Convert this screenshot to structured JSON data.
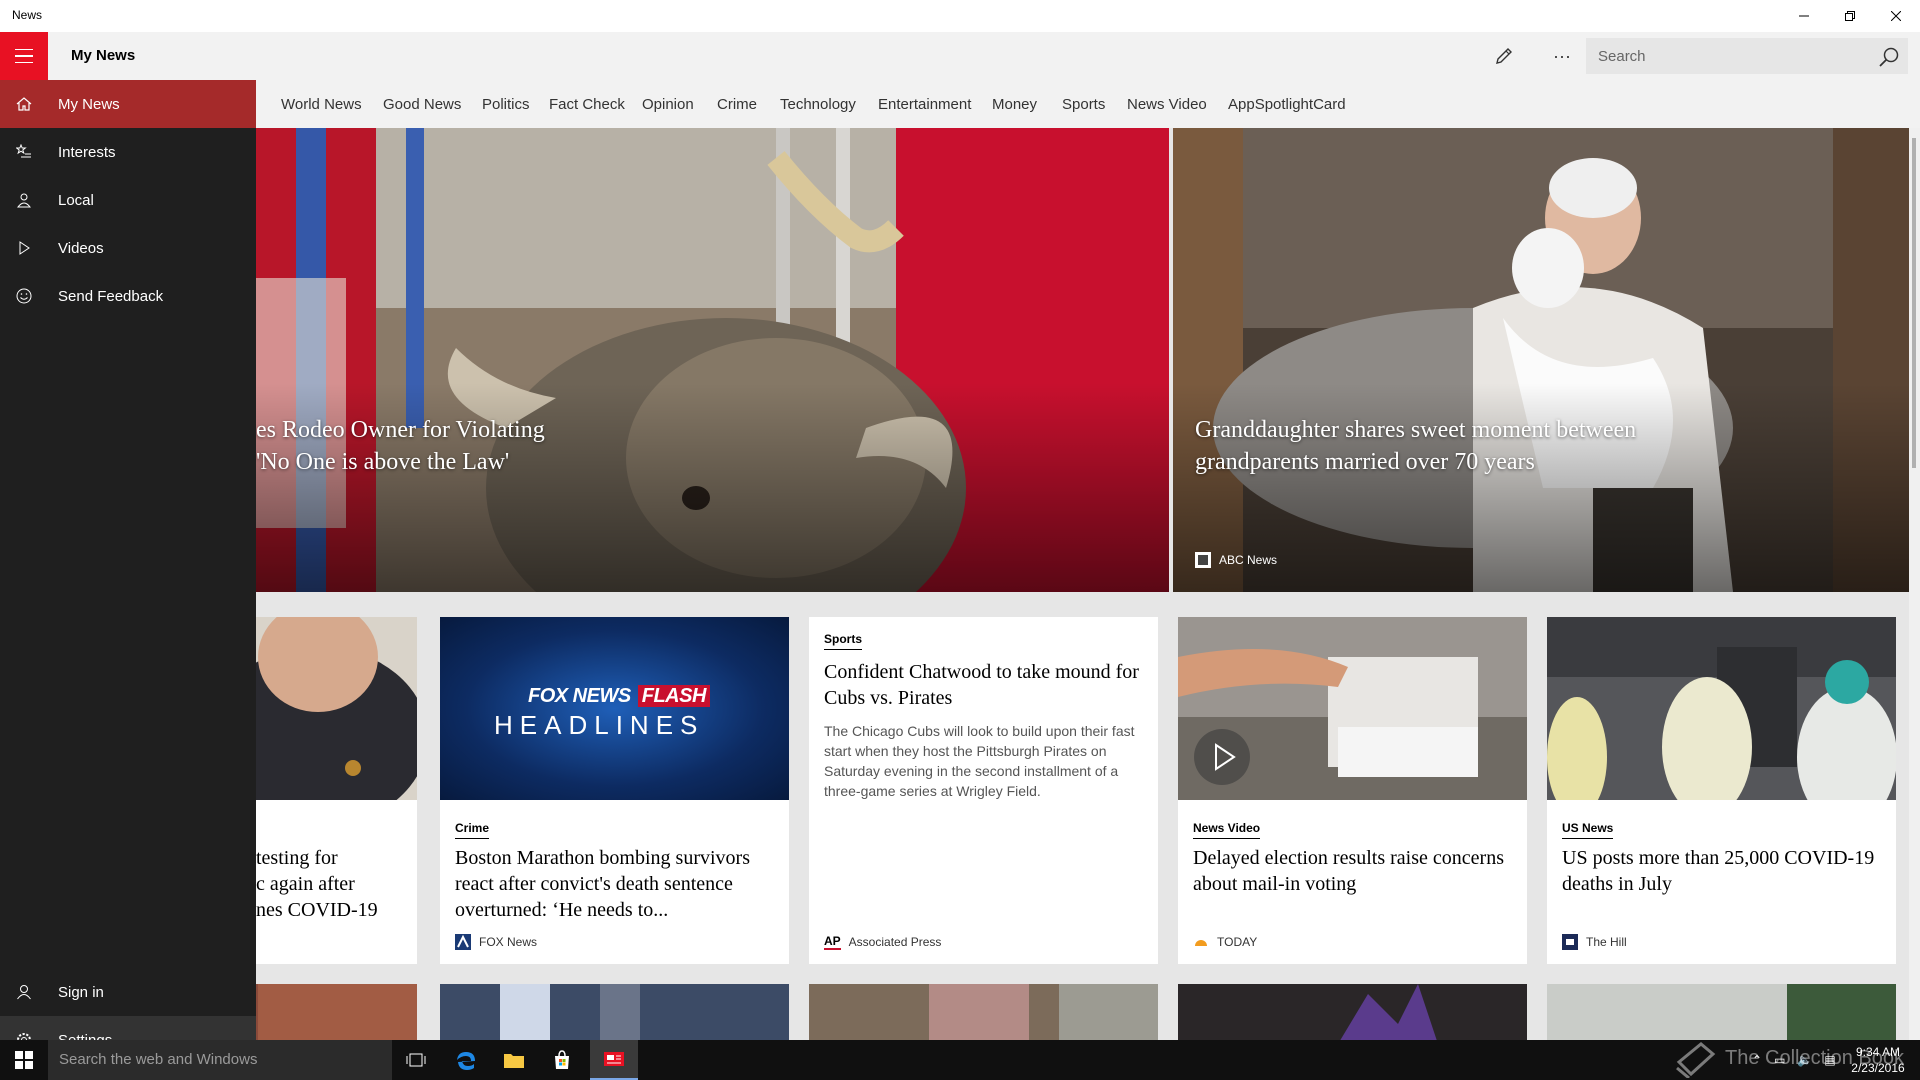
{
  "window": {
    "title": "News",
    "minimize": "–",
    "restore": "❐",
    "close": "✕"
  },
  "header": {
    "title": "My News",
    "search_placeholder": "Search",
    "more_label": "···"
  },
  "tabs": [
    "World News",
    "Good News",
    "Politics",
    "Fact Check",
    "Opinion",
    "Crime",
    "Technology",
    "Entertainment",
    "Money",
    "Sports",
    "News Video",
    "AppSpotlightCard"
  ],
  "pane": {
    "items": [
      {
        "label": "My News",
        "icon": "home-icon"
      },
      {
        "label": "Interests",
        "icon": "star-list-icon"
      },
      {
        "label": "Local",
        "icon": "person-pin-icon"
      },
      {
        "label": "Videos",
        "icon": "play-icon"
      },
      {
        "label": "Send Feedback",
        "icon": "smiley-icon"
      }
    ],
    "bottom": [
      {
        "label": "Sign in",
        "icon": "person-icon"
      },
      {
        "label": "Settings",
        "icon": "gear-icon"
      }
    ]
  },
  "hero": [
    {
      "headline_line1": "es Rodeo Owner for Violating",
      "headline_line2": "'No One is above the Law'"
    },
    {
      "headline_line1": "Granddaughter shares sweet moment between",
      "headline_line2": "grandparents married over 70 years",
      "source": "ABC News"
    }
  ],
  "cards": [
    {
      "category": "",
      "title_lines": [
        "testing for",
        "c again after",
        "nes COVID-19"
      ],
      "source": ""
    },
    {
      "category": "Crime",
      "title": "Boston Marathon bombing survivors react after convict's death sentence overturned: ‘He needs to...",
      "source": "FOX News",
      "thumb_text_top": "FOX NEWS",
      "thumb_text_flash": "FLASH",
      "thumb_text_bottom": "HEADLINES"
    },
    {
      "category": "Sports",
      "title": "Confident Chatwood to take mound for Cubs vs. Pirates",
      "summary": "The Chicago Cubs will look to build upon their fast start when they host the Pittsburgh Pirates on Saturday evening in the second installment of a three-game series at Wrigley Field.",
      "source": "Associated Press",
      "source_logo": "AP"
    },
    {
      "category": "News Video",
      "title": "Delayed election results raise concerns about mail-in voting",
      "source": "TODAY"
    },
    {
      "category": "US News",
      "title": "US posts more than 25,000 COVID-19 deaths in July",
      "source": "The Hill"
    }
  ],
  "taskbar": {
    "search_placeholder": "Search the web and Windows",
    "time": "9:34 AM",
    "date": "2/23/2016",
    "watermark": "The Collection Book"
  },
  "colors": {
    "accent": "#e81123",
    "active_pane": "#a52a2a",
    "pane_bg": "#1f1f1f"
  }
}
